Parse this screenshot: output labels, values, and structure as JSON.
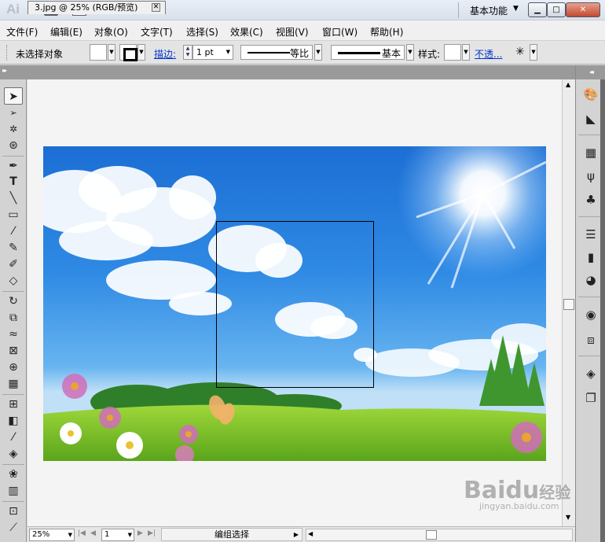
{
  "titlebar": {
    "app_logo": "Ai",
    "bridge_label": "Br",
    "workspace": "基本功能",
    "min": "▁",
    "max": "□",
    "close": "✕"
  },
  "menus": [
    "文件(F)",
    "编辑(E)",
    "对象(O)",
    "文字(T)",
    "选择(S)",
    "效果(C)",
    "视图(V)",
    "窗口(W)",
    "帮助(H)"
  ],
  "control": {
    "selection": "未选择对象",
    "stroke_link": "描边:",
    "stroke_weight": "1 pt",
    "profile": "等比",
    "brush": "基本",
    "style_label": "样式:",
    "opacity_link": "不透..."
  },
  "document": {
    "tab_title": "3.jpg @ 25% (RGB/预览)",
    "tab_close": "✕"
  },
  "status": {
    "zoom": "25%",
    "page": "1",
    "mode": "编组选择"
  },
  "tools": [
    "selection-tool",
    "direct-selection-tool",
    "magic-wand-tool",
    "lasso-tool",
    "pen-tool",
    "type-tool",
    "line-segment-tool",
    "rectangle-tool",
    "paintbrush-tool",
    "pencil-tool",
    "blob-brush-tool",
    "eraser-tool",
    "rotate-tool",
    "scale-tool",
    "width-tool",
    "free-transform-tool",
    "shape-builder-tool",
    "perspective-grid-tool",
    "mesh-tool",
    "gradient-tool",
    "eyedropper-tool",
    "blend-tool",
    "symbol-sprayer-tool",
    "column-graph-tool",
    "artboard-tool",
    "slice-tool"
  ],
  "watermark": {
    "brand": "Bai",
    "paw": "du",
    "suffix": "经验",
    "url": "jingyan.baidu.com"
  }
}
